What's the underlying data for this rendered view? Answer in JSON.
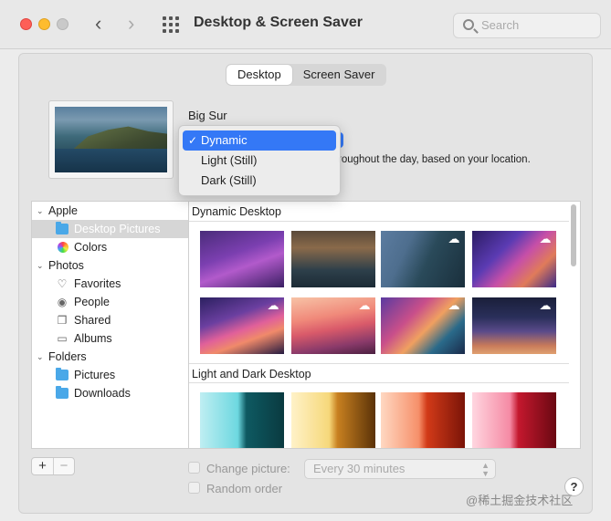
{
  "window": {
    "title": "Desktop & Screen Saver"
  },
  "search": {
    "placeholder": "Search"
  },
  "tabs": [
    {
      "label": "Desktop",
      "active": true
    },
    {
      "label": "Screen Saver",
      "active": false
    }
  ],
  "wallpaper": {
    "name": "Big Sur",
    "description": "roughout the day, based on your location."
  },
  "appearance_menu": {
    "options": [
      {
        "label": "Dynamic",
        "selected": true
      },
      {
        "label": "Light (Still)",
        "selected": false
      },
      {
        "label": "Dark (Still)",
        "selected": false
      }
    ]
  },
  "sidebar": {
    "groups": [
      {
        "label": "Apple",
        "items": [
          {
            "label": "Desktop Pictures",
            "icon": "folder-icon",
            "selected": true
          },
          {
            "label": "Colors",
            "icon": "colors-icon"
          }
        ]
      },
      {
        "label": "Photos",
        "items": [
          {
            "label": "Favorites",
            "icon": "heart-icon"
          },
          {
            "label": "People",
            "icon": "person-icon"
          },
          {
            "label": "Shared",
            "icon": "shared-icon"
          },
          {
            "label": "Albums",
            "icon": "albums-icon"
          }
        ]
      },
      {
        "label": "Folders",
        "items": [
          {
            "label": "Pictures",
            "icon": "folder-icon"
          },
          {
            "label": "Downloads",
            "icon": "folder-icon"
          }
        ]
      }
    ]
  },
  "gallery": {
    "sections": [
      {
        "title": "Dynamic Desktop"
      },
      {
        "title": "Light and Dark Desktop"
      }
    ]
  },
  "controls": {
    "add_label": "+",
    "remove_label": "−",
    "change_picture_label": "Change picture:",
    "change_picture_checked": false,
    "interval": "Every 30 minutes",
    "random_order_label": "Random order",
    "random_order_checked": false,
    "help_label": "?"
  },
  "watermark": "@稀土掘金技术社区",
  "colors": {
    "accent": "#3478f6",
    "selection": "#d6d6d6"
  }
}
